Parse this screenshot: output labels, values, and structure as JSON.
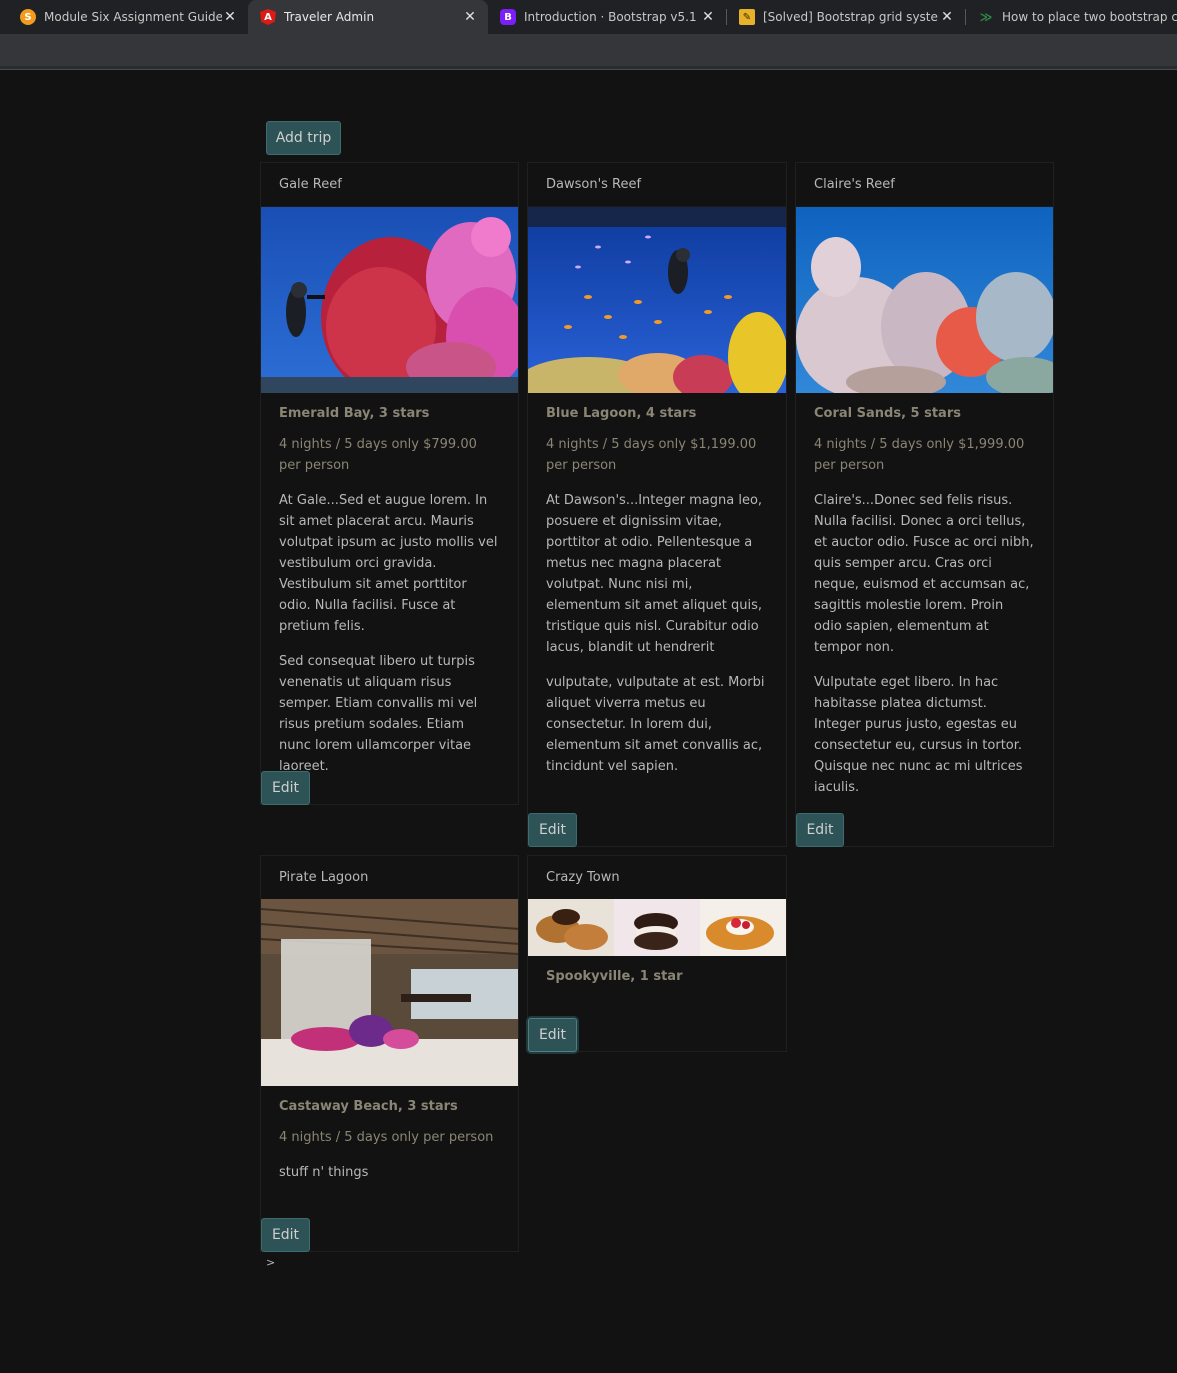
{
  "browser": {
    "tabs": [
      {
        "title": "Module Six Assignment Guideline",
        "favicon": "snhu-icon",
        "favicon_color": "#f29b1d",
        "active": false
      },
      {
        "title": "Traveler Admin",
        "favicon": "angular-icon",
        "favicon_color": "#dd1b16",
        "active": true
      },
      {
        "title": "Introduction · Bootstrap v5.1",
        "favicon": "bootstrap-icon",
        "favicon_color": "#7952b3",
        "active": false
      },
      {
        "title": "[Solved] Bootstrap grid system n",
        "favicon": "solved-icon",
        "favicon_color": "#e8b12a",
        "active": false
      },
      {
        "title": "How to place two bootstrap card",
        "favicon": "gfg-icon",
        "favicon_color": "#2f8d46",
        "active": false
      }
    ],
    "favicon_letters": {
      "snhu": "S",
      "angular": "A",
      "bootstrap": "B",
      "solved": "✎",
      "gfg": "≫"
    }
  },
  "page": {
    "add_trip_label": "Add trip",
    "footer_text": ">",
    "cards": [
      {
        "name": "Gale Reef",
        "subtitle": "Emerald Bay, 3 stars",
        "price": "4 nights / 5 days only $799.00 per person",
        "paragraphs": [
          "At Gale...Sed et augue lorem. In sit amet placerat arcu. Mauris volutpat ipsum ac justo mollis vel vestibulum orci gravida. Vestibulum sit amet porttitor odio. Nulla facilisi. Fusce at pretium felis.",
          "Sed consequat libero ut turpis venenatis ut aliquam risus semper. Etiam convallis mi vel risus pretium sodales. Etiam nunc lorem ullamcorper vitae laoreet."
        ],
        "edit_label": "Edit",
        "image": "reef-diver-photo"
      },
      {
        "name": "Dawson's Reef",
        "subtitle": "Blue Lagoon, 4 stars",
        "price": "4 nights / 5 days only $1,199.00 per person",
        "paragraphs": [
          "At Dawson's...Integer magna leo, posuere et dignissim vitae, porttitor at odio. Pellentesque a metus nec magna placerat volutpat. Nunc nisi mi, elementum sit amet aliquet quis, tristique quis nisl. Curabitur odio lacus, blandit ut hendrerit",
          "vulputate, vulputate at est. Morbi aliquet viverra metus eu consectetur. In lorem dui, elementum sit amet convallis ac, tincidunt vel sapien."
        ],
        "edit_label": "Edit",
        "image": "reef-fish-photo"
      },
      {
        "name": "Claire's Reef",
        "subtitle": "Coral Sands, 5 stars",
        "price": "4 nights / 5 days only $1,999.00 per person",
        "paragraphs": [
          "Claire's...Donec sed felis risus. Nulla facilisi. Donec a orci tellus, et auctor odio. Fusce ac orci nibh, quis semper arcu. Cras orci neque, euismod et accumsan ac, sagittis molestie lorem. Proin odio sapien, elementum at tempor non.",
          "Vulputate eget libero. In hac habitasse platea dictumst. Integer purus justo, egestas eu consectetur eu, cursus in tortor. Quisque nec nunc ac mi ultrices iaculis."
        ],
        "edit_label": "Edit",
        "image": "coral-photo"
      },
      {
        "name": "Pirate Lagoon",
        "subtitle": "Castaway Beach, 3 stars",
        "price": "4 nights / 5 days only per person",
        "paragraphs": [
          "stuff n' things"
        ],
        "edit_label": "Edit",
        "image": "bungalow-bedroom-photo"
      },
      {
        "name": "Crazy Town",
        "subtitle": "Spookyville, 1 star",
        "price": "",
        "paragraphs": [],
        "edit_label": "Edit",
        "image": "desserts-photo"
      }
    ]
  }
}
